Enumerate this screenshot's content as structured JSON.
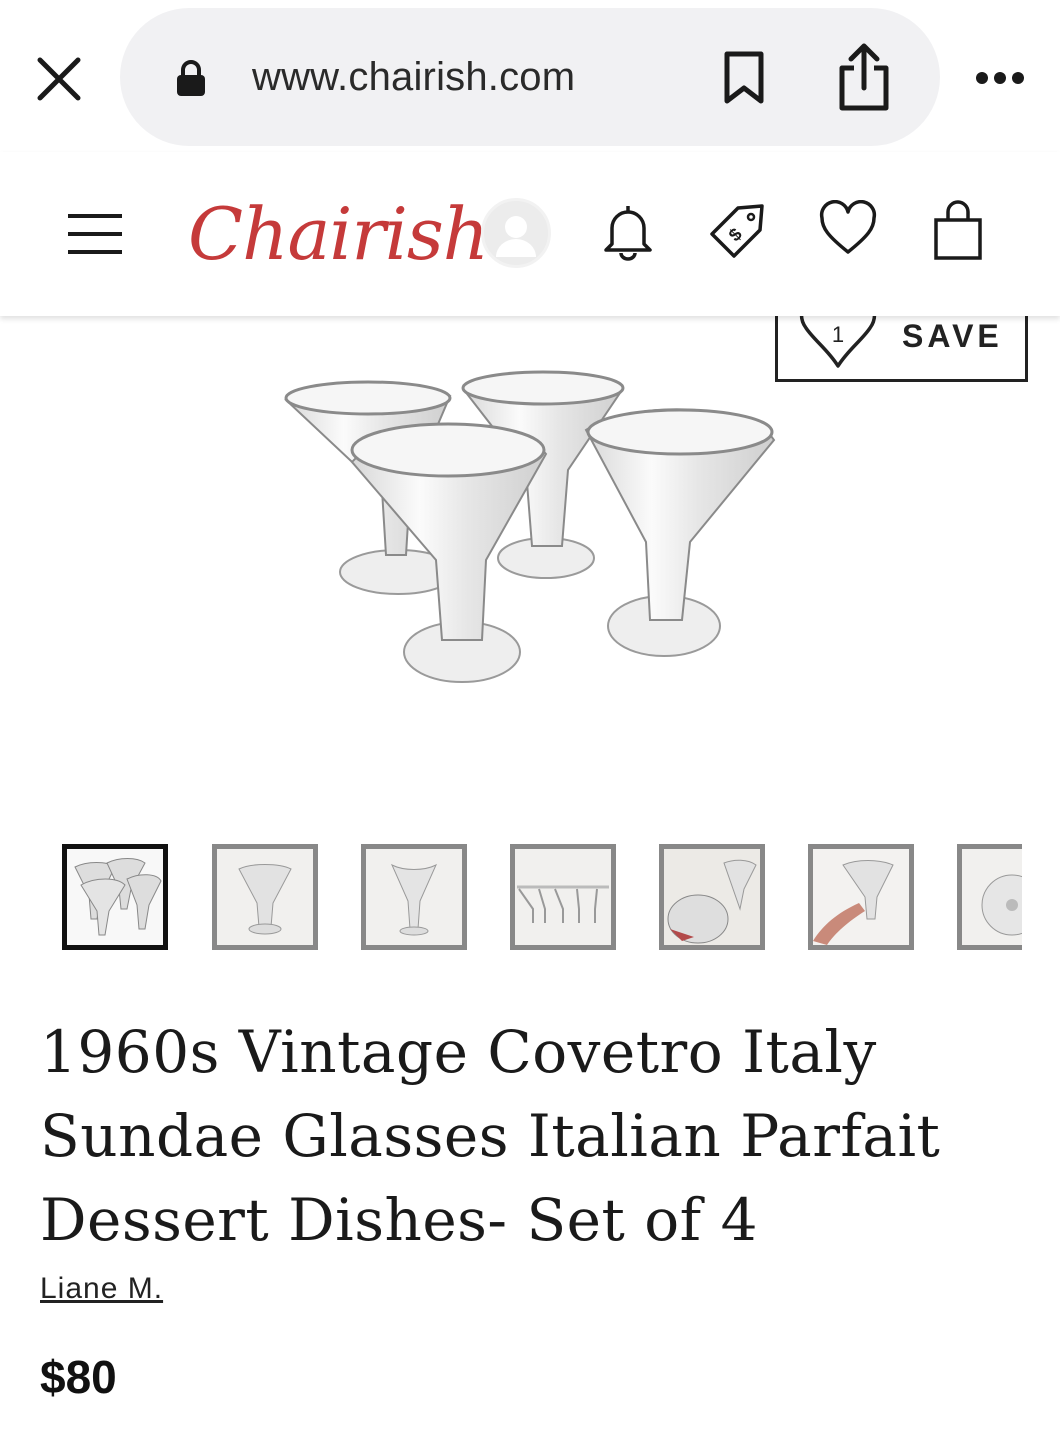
{
  "browser": {
    "url": "www.chairish.com",
    "icons": [
      "close-icon",
      "lock-icon",
      "bookmark-icon",
      "share-icon",
      "more-icon"
    ]
  },
  "header": {
    "logo": "Chairish",
    "icons": [
      "menu-icon",
      "avatar-icon",
      "bell-icon",
      "price-tag-icon",
      "heart-icon",
      "shopping-bag-icon"
    ],
    "brand_color": "#c53a3a"
  },
  "product": {
    "save_count": "1",
    "save_label": "SAVE",
    "title": "1960s Vintage Covetro Italy Sundae Glasses Italian Parfait Dessert Dishes- Set of 4",
    "seller": "Liane M.",
    "price": "$80",
    "thumbnail_count": 7,
    "active_thumbnail": 1
  }
}
